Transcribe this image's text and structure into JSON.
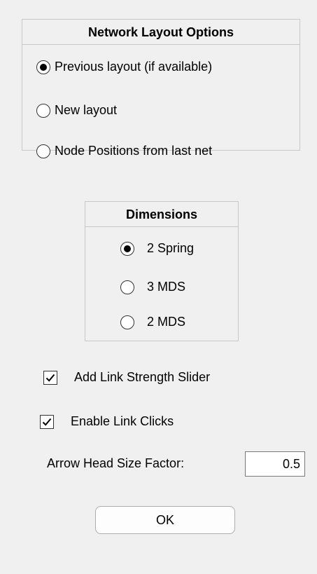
{
  "layout_panel": {
    "title": "Network Layout Options",
    "options": [
      {
        "label": "Previous layout (if available)",
        "checked": true
      },
      {
        "label": "New layout",
        "checked": false
      },
      {
        "label": "Node Positions from last net",
        "checked": false
      }
    ]
  },
  "dimensions_panel": {
    "title": "Dimensions",
    "options": [
      {
        "label": "2 Spring",
        "checked": true
      },
      {
        "label": "3 MDS",
        "checked": false
      },
      {
        "label": "2 MDS",
        "checked": false
      }
    ]
  },
  "checkboxes": [
    {
      "label": "Add Link Strength Slider",
      "checked": true
    },
    {
      "label": "Enable Link Clicks",
      "checked": true
    }
  ],
  "arrow_head": {
    "label": "Arrow Head Size Factor:",
    "value": "0.5"
  },
  "ok_button": {
    "label": "OK"
  }
}
